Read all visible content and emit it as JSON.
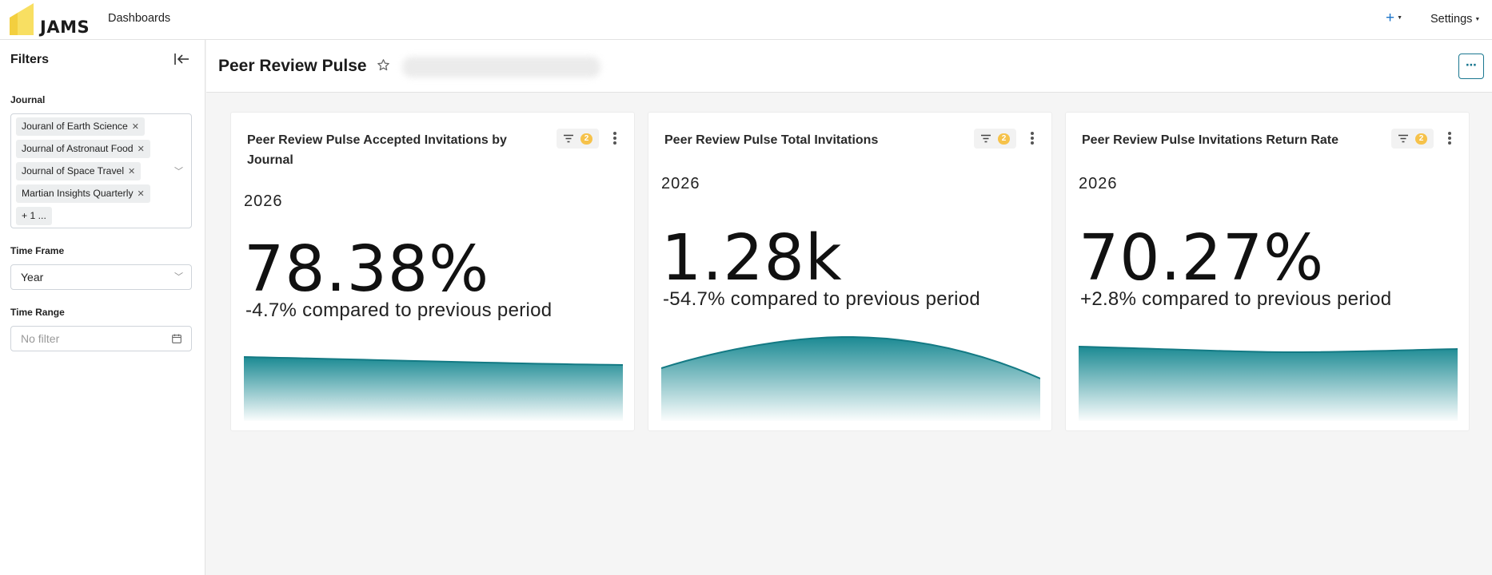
{
  "app": {
    "logo_text": "JAMS",
    "brand_color": "#f6d64a",
    "accent_color": "#1a7790"
  },
  "nav": {
    "dashboards": "Dashboards",
    "plus": "+",
    "settings": "Settings"
  },
  "sidebar": {
    "title": "Filters",
    "journal_label": "Journal",
    "journal_chips": [
      "Jouranl of Earth Science",
      "Journal of Astronaut Food",
      "Journal of Space Travel",
      "Martian Insights Quarterly",
      "+ 1 ..."
    ],
    "time_frame_label": "Time Frame",
    "time_frame_value": "Year",
    "time_range_label": "Time Range",
    "time_range_placeholder": "No filter"
  },
  "header": {
    "title": "Peer Review Pulse",
    "more": "⋯"
  },
  "cards": [
    {
      "title": "Peer Review Pulse Accepted Invitations by Journal",
      "filter_count": "2",
      "period": "2026",
      "value": "78.38%",
      "change": "-4.7% compared to previous period",
      "trend": "slightly-declining"
    },
    {
      "title": "Peer Review Pulse Total Invitations",
      "filter_count": "2",
      "period": "2026",
      "value": "1.28k",
      "change": "-54.7% compared to previous period",
      "trend": "rise-then-fall"
    },
    {
      "title": "Peer Review Pulse Invitations Return Rate",
      "filter_count": "2",
      "period": "2026",
      "value": "70.27%",
      "change": "+2.8% compared to previous period",
      "trend": "flat"
    }
  ]
}
